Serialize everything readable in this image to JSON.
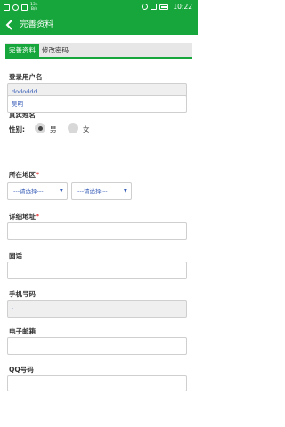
{
  "statusbar": {
    "netspeed": "134\nB/s",
    "clock": "10:22"
  },
  "nav": {
    "title": "完善资料"
  },
  "tabs": [
    {
      "label": "完善资料"
    },
    {
      "label": "修改密码"
    }
  ],
  "form": {
    "username_label": "登录用户名",
    "username_value": "dododdd",
    "realname_label": "真实姓名",
    "realname_value": "吴明",
    "gender_label": "性别:",
    "gender_male": "男",
    "gender_female": "女",
    "region_label": "所在地区",
    "required_mark": "*",
    "province_placeholder": "---请选择---",
    "city_placeholder": "---请选择---",
    "address_label": "详细地址",
    "phone_label": "固话",
    "mobile_label": "手机号码",
    "mobile_value": "·",
    "email_label": "电子邮箱",
    "qq_label": "QQ号码"
  },
  "icons": {
    "accent": "#17a63b",
    "back": "chevron-left-icon"
  }
}
